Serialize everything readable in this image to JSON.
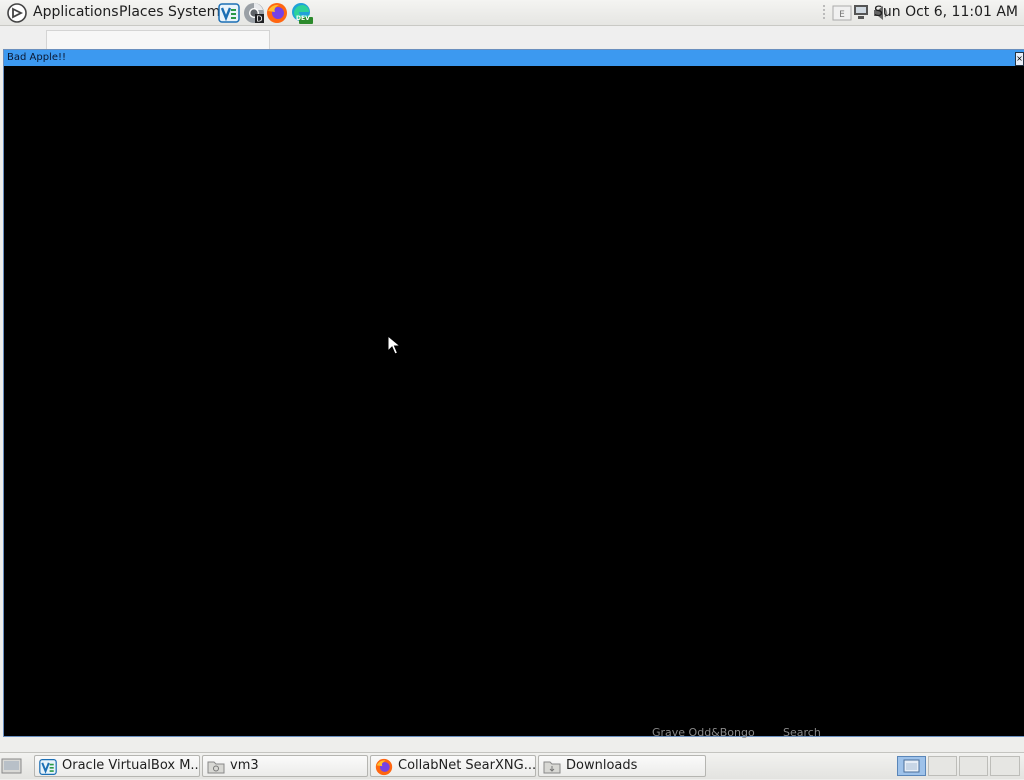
{
  "top_panel": {
    "menus": [
      "Applications",
      "Places",
      "System"
    ],
    "launchers": [
      {
        "name": "virtualbox-icon"
      },
      {
        "name": "chrome-dev-icon"
      },
      {
        "name": "firefox-icon"
      },
      {
        "name": "edge-dev-icon",
        "badge": "DEV"
      }
    ],
    "clock": "Sun Oct  6, 11:01 AM"
  },
  "window": {
    "title": "Bad Apple!!",
    "close_glyph": "×"
  },
  "behind_window_text": {
    "left": "Grave  Odd&Bongo",
    "right": "Search"
  },
  "taskbar": {
    "tasks": [
      {
        "label": "Oracle VirtualBox M...",
        "icon": "virtualbox-icon"
      },
      {
        "label": "vm3",
        "icon": "folder-icon"
      },
      {
        "label": "CollabNet SearXNG...",
        "icon": "firefox-icon"
      },
      {
        "label": "Downloads",
        "icon": "folder-icon"
      }
    ]
  },
  "colors": {
    "titlebar": "#3c99f0",
    "canvas": "#000000"
  }
}
